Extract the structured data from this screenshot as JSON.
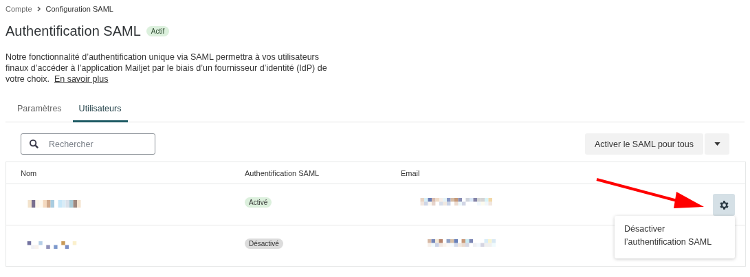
{
  "breadcrumb": [
    "Compte",
    "Configuration SAML"
  ],
  "title": "Authentification SAML",
  "title_badge": "Actif",
  "description": "Notre fonctionnalité d’authentification unique via SAML permettra à vos utilisateurs finaux d’accéder à l’application Mailjet par le biais d’un fournisseur d’identité (IdP) de votre choix.",
  "learn_more": "En savoir plus",
  "tabs": [
    {
      "label": "Paramètres",
      "selected": false
    },
    {
      "label": "Utilisateurs",
      "selected": true
    }
  ],
  "search": {
    "placeholder": "Rechercher"
  },
  "bulk_button": "Activer le SAML pour tous",
  "table": {
    "columns": [
      "Nom",
      "Authentification SAML",
      "Email"
    ],
    "rows": [
      {
        "status": "Activé",
        "active": true,
        "menu_open": true
      },
      {
        "status": "Désactivé",
        "active": false,
        "menu_open": false
      }
    ]
  },
  "menu": {
    "items": [
      "Désactiver l’authentification SAML"
    ]
  }
}
